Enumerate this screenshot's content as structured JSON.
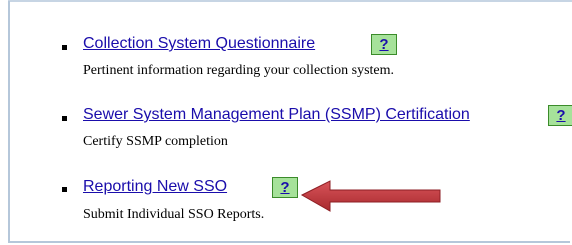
{
  "items": [
    {
      "link": "Collection System Questionnaire",
      "help": "?",
      "desc": "Pertinent information regarding your collection system."
    },
    {
      "link": "Sewer System Management Plan (SSMP) Certification",
      "help": "?",
      "desc": "Certify SSMP completion"
    },
    {
      "link": "Reporting New SSO",
      "help": "?",
      "desc": "Submit Individual SSO Reports."
    }
  ],
  "colors": {
    "link": "#1a0dab",
    "help_bg": "#a6e29a",
    "arrow": "#c0383a",
    "frame": "#b5c7da"
  }
}
